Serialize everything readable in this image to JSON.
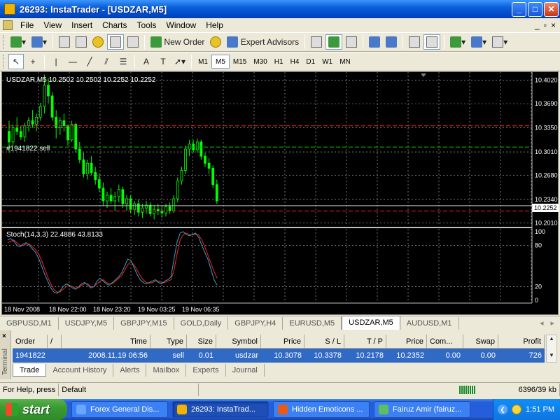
{
  "window": {
    "title": "26293: InstaTrader - [USDZAR,M5]"
  },
  "menu": {
    "items": [
      "File",
      "View",
      "Insert",
      "Charts",
      "Tools",
      "Window",
      "Help"
    ],
    "mdi_buttons": [
      "_",
      "▫",
      "×"
    ]
  },
  "toolbar1": {
    "new_order": "New Order",
    "expert_advisors": "Expert Advisors"
  },
  "timeframes": [
    "M1",
    "M5",
    "M15",
    "M30",
    "H1",
    "H4",
    "D1",
    "W1",
    "MN"
  ],
  "active_timeframe": "M5",
  "chart": {
    "header": "USDZAR,M5  10.2502 10.2502 10.2252 10.2252",
    "price_labels": [
      "10.4020",
      "10.3690",
      "10.3350",
      "10.3010",
      "10.2680",
      "10.2340",
      "10.2010"
    ],
    "current_price_label": "10.2252",
    "order_label": "#1941822 sell",
    "stoch_header": "Stoch(14,3,3) 22.4886 43.8133",
    "stoch_levels": [
      "100",
      "80",
      "20",
      "0"
    ],
    "time_labels": [
      "18 Nov 2008",
      "18 Nov 22:00",
      "18 Nov 23:20",
      "19 Nov 03:25",
      "19 Nov 06:35"
    ],
    "colors": {
      "candles": "#00ff00",
      "grid": "#c0c0c0",
      "order_line": "#00c000",
      "sl_line": "#ff2020",
      "stoch_main": "#3aa0d0",
      "stoch_signal": "#ff2020"
    }
  },
  "symbol_tabs": [
    "GBPUSD,M1",
    "USDJPY,M5",
    "GBPJPY,M15",
    "GOLD,Daily",
    "GBPJPY,H4",
    "EURUSD,M5",
    "USDZAR,M5",
    "AUDUSD,M1"
  ],
  "active_symbol_tab": "USDZAR,M5",
  "terminal": {
    "side_label": "Terminal",
    "columns": [
      "Order",
      "/",
      "Time",
      "Type",
      "Size",
      "Symbol",
      "Price",
      "S / L",
      "T / P",
      "Price",
      "Com...",
      "Swap",
      "Profit"
    ],
    "rows": [
      {
        "order": "1941822",
        "time": "2008.11.19 06:56",
        "type": "sell",
        "size": "0.01",
        "symbol": "usdzar",
        "price": "10.3078",
        "sl": "10.3378",
        "tp": "10.2178",
        "cur_price": "10.2352",
        "commission": "0.00",
        "swap": "0.00",
        "profit": "726"
      }
    ],
    "tabs": [
      "Trade",
      "Account History",
      "Alerts",
      "Mailbox",
      "Experts",
      "Journal"
    ],
    "active_tab": "Trade"
  },
  "status": {
    "help": "For Help, press",
    "profile": "Default",
    "traffic": "6396/39 kb"
  },
  "taskbar": {
    "start": "start",
    "tasks": [
      "Forex General Dis...",
      "26293: InstaTrad...",
      "Hidden Emoticons ...",
      "Fairuz Amir (fairuz..."
    ],
    "active_task": 1,
    "clock": "1:51 PM"
  }
}
